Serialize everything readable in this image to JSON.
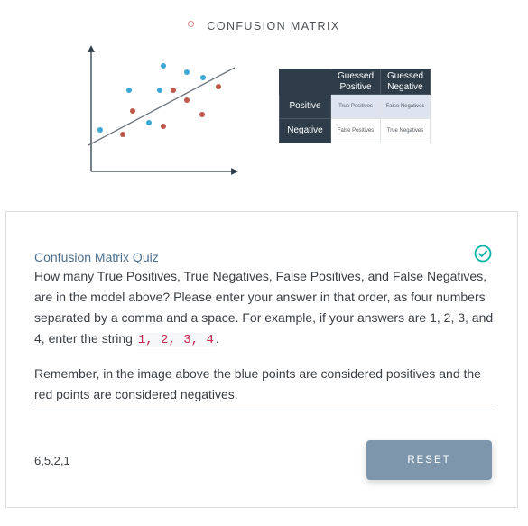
{
  "header": {
    "title": "CONFUSION MATRIX"
  },
  "figure": {
    "point_colors": {
      "positive": "#3aa7d4",
      "negative": "#c0584a"
    }
  },
  "matrix": {
    "col_headers": [
      [
        "Guessed",
        "Positive"
      ],
      [
        "Guessed",
        "Negative"
      ]
    ],
    "rows": [
      {
        "label": "Positive",
        "cells": [
          "True Positives",
          "False Negatives"
        ]
      },
      {
        "label": "Negative",
        "cells": [
          "False Positives",
          "True Negatives"
        ]
      }
    ],
    "header_color": "#2e3d49"
  },
  "quiz": {
    "title": "Confusion Matrix Quiz",
    "question_before": "How many True Positives, True Negatives, False Positives, and False Negatives, are in the model above? Please enter your answer in that order, as four numbers separated by a comma and a space. For example, if your answers are 1, 2, 3, and 4, enter the string ",
    "example_code": "1, 2, 3, 4",
    "question_after": ".",
    "note": "Remember, in the image above the blue points are considered positives and the red points are considered negatives.",
    "answer": "6,5,2,1",
    "reset_label": "RESET",
    "status": "correct",
    "accent_color": "#02b3a4"
  }
}
